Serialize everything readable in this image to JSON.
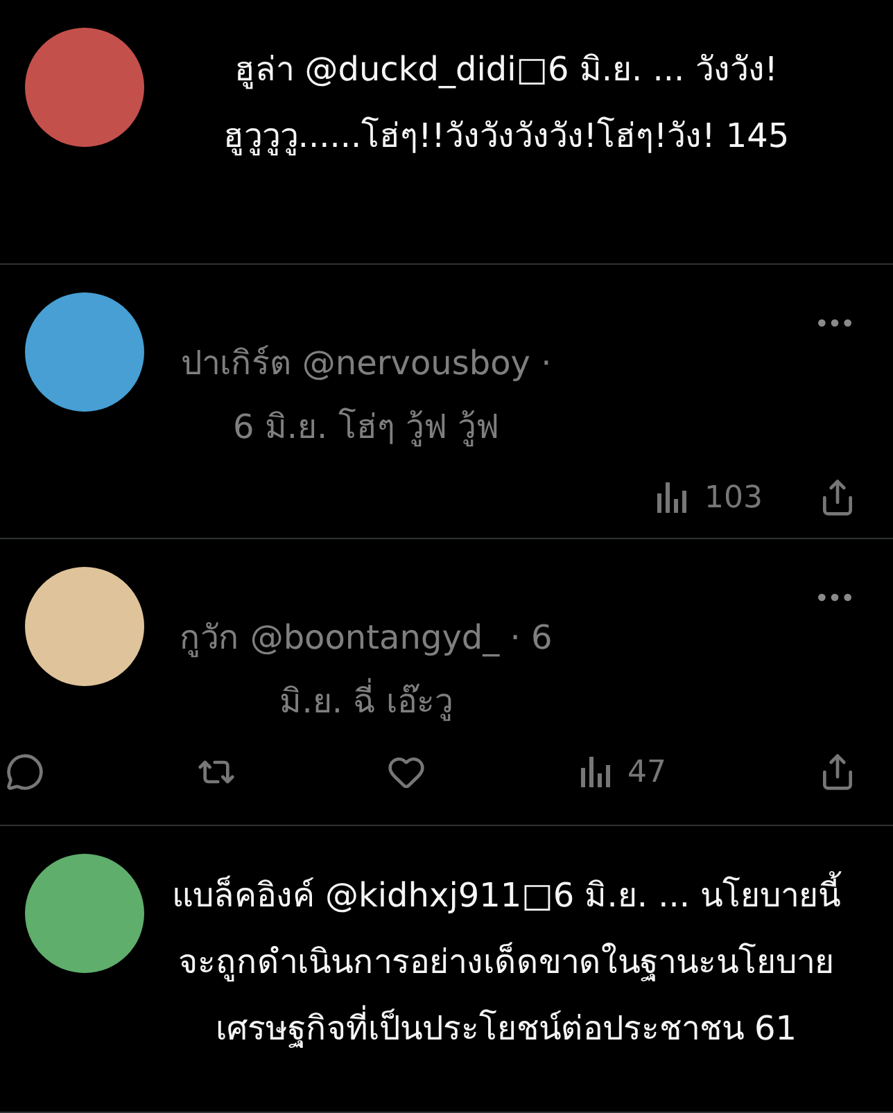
{
  "posts": [
    {
      "kind": "expanded",
      "color": "#c4504c",
      "lines": [
        "ฮูล่า @duckd_didi□6 มิ.ย. ... วังวัง!",
        "ฮูวูวูวู......โฮ่ๆ!!วังวังวังวัง!โฮ่ๆ!วัง! 145"
      ]
    },
    {
      "kind": "compact",
      "color": "#479fd3",
      "lines": [
        "ปาเกิร์ต @nervousboy ·",
        "6 มิ.ย. โฮ่ๆ วู้ฟ วู้ฟ"
      ],
      "actions": [
        {
          "kind": "views",
          "count": "103"
        },
        {
          "kind": "share"
        }
      ]
    },
    {
      "kind": "compact",
      "color": "#dfc39b",
      "lines": [
        "กูวัก @boontangyd_ · 6",
        "มิ.ย. ฉี่ เอ๊ะวู"
      ],
      "actions": [
        {
          "kind": "reply"
        },
        {
          "kind": "repost"
        },
        {
          "kind": "like"
        },
        {
          "kind": "views",
          "count": "47"
        },
        {
          "kind": "share"
        }
      ]
    },
    {
      "kind": "expanded",
      "color": "#5fae6c",
      "lines": [
        "แบล็คอิงค์ @kidhxj911□6 มิ.ย. ... นโยบายนี้",
        "จะถูกดำเนินการอย่างเด็ดขาดในฐานะนโยบาย",
        "เศรษฐกิจที่เป็นประโยชน์ต่อประชาชน 61"
      ]
    }
  ]
}
